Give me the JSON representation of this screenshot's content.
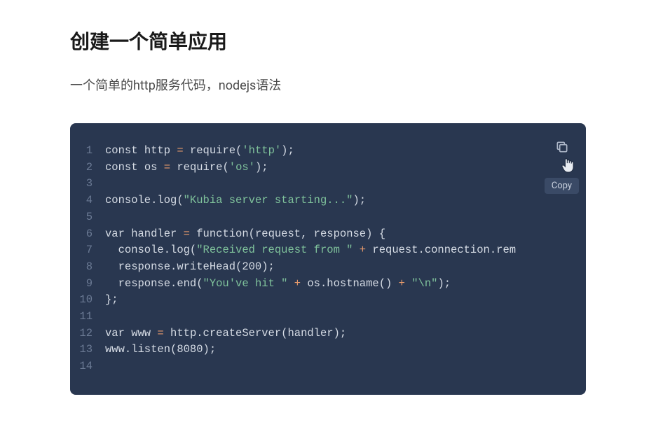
{
  "heading": "创建一个简单应用",
  "description": "一个简单的http服务代码，nodejs语法",
  "copy_tooltip": "Copy",
  "code_lines": [
    {
      "n": "1",
      "tokens": [
        [
          "kw",
          "const"
        ],
        [
          "plain",
          " http "
        ],
        [
          "op",
          "="
        ],
        [
          "plain",
          " require("
        ],
        [
          "str",
          "'http'"
        ],
        [
          "plain",
          ");"
        ]
      ]
    },
    {
      "n": "2",
      "tokens": [
        [
          "kw",
          "const"
        ],
        [
          "plain",
          " os "
        ],
        [
          "op",
          "="
        ],
        [
          "plain",
          " require("
        ],
        [
          "str",
          "'os'"
        ],
        [
          "plain",
          ");"
        ]
      ]
    },
    {
      "n": "3",
      "tokens": []
    },
    {
      "n": "4",
      "tokens": [
        [
          "plain",
          "console.log("
        ],
        [
          "str",
          "\"Kubia server starting...\""
        ],
        [
          "plain",
          ");"
        ]
      ]
    },
    {
      "n": "5",
      "tokens": []
    },
    {
      "n": "6",
      "tokens": [
        [
          "kw",
          "var"
        ],
        [
          "plain",
          " handler "
        ],
        [
          "op",
          "="
        ],
        [
          "plain",
          " "
        ],
        [
          "kw",
          "function"
        ],
        [
          "plain",
          "(request, response) {"
        ]
      ]
    },
    {
      "n": "7",
      "tokens": [
        [
          "plain",
          "  console.log("
        ],
        [
          "str",
          "\"Received request from \""
        ],
        [
          "plain",
          " "
        ],
        [
          "op",
          "+"
        ],
        [
          "plain",
          " request.connection.rem"
        ]
      ]
    },
    {
      "n": "8",
      "tokens": [
        [
          "plain",
          "  response.writeHead(200);"
        ]
      ]
    },
    {
      "n": "9",
      "tokens": [
        [
          "plain",
          "  response.end("
        ],
        [
          "str",
          "\"You've hit \""
        ],
        [
          "plain",
          " "
        ],
        [
          "op",
          "+"
        ],
        [
          "plain",
          " os.hostname() "
        ],
        [
          "op",
          "+"
        ],
        [
          "plain",
          " "
        ],
        [
          "str",
          "\"\\n\""
        ],
        [
          "plain",
          ");"
        ]
      ]
    },
    {
      "n": "10",
      "tokens": [
        [
          "plain",
          "};"
        ]
      ]
    },
    {
      "n": "11",
      "tokens": []
    },
    {
      "n": "12",
      "tokens": [
        [
          "kw",
          "var"
        ],
        [
          "plain",
          " www "
        ],
        [
          "op",
          "="
        ],
        [
          "plain",
          " http.createServer(handler);"
        ]
      ]
    },
    {
      "n": "13",
      "tokens": [
        [
          "plain",
          "www.listen(8080);"
        ]
      ]
    },
    {
      "n": "14",
      "tokens": []
    }
  ]
}
